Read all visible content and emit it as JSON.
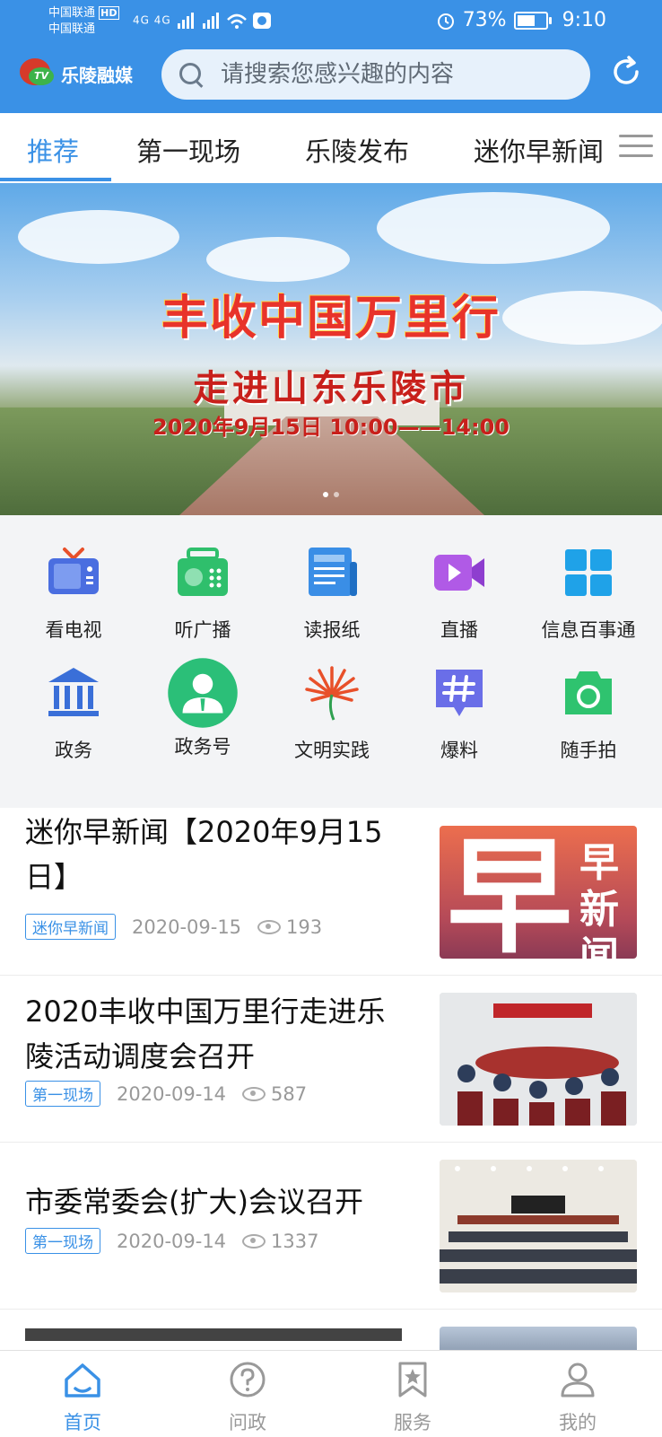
{
  "status_bar": {
    "carrier_1": "中国联通",
    "carrier_1_badge": "HD",
    "carrier_2": "中国联通",
    "network": "4G 4G",
    "battery": "73%",
    "battery_level": 0.73,
    "time": "9:10"
  },
  "header": {
    "logo_badge": "TV",
    "logo_text": "乐陵融媒",
    "search_placeholder": "请搜索您感兴趣的内容",
    "accent_color": "#3a91e6"
  },
  "tabs": [
    {
      "label": "推荐",
      "active": true
    },
    {
      "label": "第一现场",
      "active": false
    },
    {
      "label": "乐陵发布",
      "active": false
    },
    {
      "label": "迷你早新闻",
      "active": false
    }
  ],
  "banner": {
    "headline": "丰收中国万里行",
    "subheadline": "走进山东乐陵市",
    "time_range": "2020年9月15日 10:00——14:00",
    "slide_count": 2,
    "active_slide": 1
  },
  "services": [
    {
      "label": "看电视",
      "icon": "tv-icon",
      "color": "#4a6ee0"
    },
    {
      "label": "听广播",
      "icon": "radio-icon",
      "color": "#2fbf6c"
    },
    {
      "label": "读报纸",
      "icon": "newspaper-icon",
      "color": "#3a8ee6"
    },
    {
      "label": "直播",
      "icon": "live-video-icon",
      "color": "#b05ae6"
    },
    {
      "label": "信息百事通",
      "icon": "grid-apps-icon",
      "color": "#1fa2e8"
    },
    {
      "label": "政务",
      "icon": "government-building-icon",
      "color": "#3a6fd8"
    },
    {
      "label": "政务号",
      "icon": "official-account-icon",
      "color": "#2bbf78"
    },
    {
      "label": "文明实践",
      "icon": "civilization-flower-icon",
      "color": "#e8502a"
    },
    {
      "label": "爆料",
      "icon": "hashtag-icon",
      "color": "#6a6ee8"
    },
    {
      "label": "随手拍",
      "icon": "camera-icon",
      "color": "#2fc36f"
    }
  ],
  "news": [
    {
      "title": "迷你早新闻【2020年9月15日】",
      "tag": "迷你早新闻",
      "date": "2020-09-15",
      "views": "193",
      "thumb": "早新闻"
    },
    {
      "title": "2020丰收中国万里行走进乐陵活动调度会召开",
      "tag": "第一现场",
      "date": "2020-09-14",
      "views": "587",
      "thumb": ""
    },
    {
      "title": "市委常委会(扩大)会议召开",
      "tag": "第一现场",
      "date": "2020-09-14",
      "views": "1337",
      "thumb": ""
    }
  ],
  "bottom_nav": [
    {
      "label": "首页",
      "icon": "home-icon",
      "active": true
    },
    {
      "label": "问政",
      "icon": "question-icon",
      "active": false
    },
    {
      "label": "服务",
      "icon": "bookmark-star-icon",
      "active": false
    },
    {
      "label": "我的",
      "icon": "profile-icon",
      "active": false
    }
  ]
}
